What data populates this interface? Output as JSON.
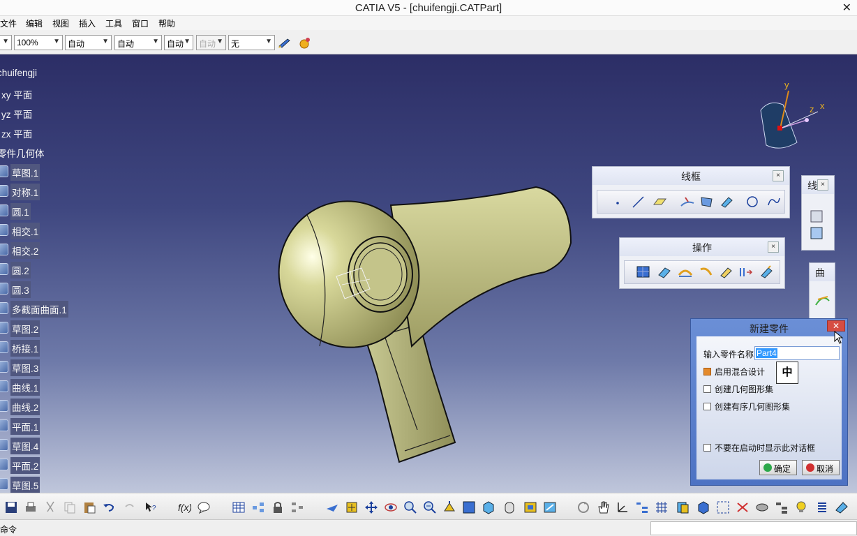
{
  "window": {
    "title": "CATIA V5 - [chuifengji.CATPart]",
    "close_glyph": "✕"
  },
  "menu": [
    "文件",
    "编辑",
    "视图",
    "插入",
    "工具",
    "窗口",
    "帮助"
  ],
  "toolbar": {
    "zoom": "100%",
    "sel_auto1": "自动",
    "sel_auto2": "自动",
    "sel_auto3": "自动",
    "sel_auto4": "自动",
    "sel_none": "无"
  },
  "tree": {
    "root": "chuifengji",
    "items": [
      "xy 平面",
      "yz 平面",
      "zx 平面",
      "零件几何体",
      "草图.1",
      "对称.1",
      "圆.1",
      "相交.1",
      "相交.2",
      "圆.2",
      "圆.3",
      "多截面曲面.1",
      "草图.2",
      "桥接.1",
      "草图.3",
      "曲线.1",
      "曲线.2",
      "平面.1",
      "草图.4",
      "平面.2",
      "草图.5"
    ]
  },
  "compass": {
    "y": "y",
    "z": "z",
    "x": "x"
  },
  "toolbars": {
    "wireframe_title": "线框",
    "operations_title": "操作",
    "partial_title_1": "线",
    "partial_title_2": "曲",
    "close": "×"
  },
  "dialog": {
    "title": "新建零件",
    "close": "✕",
    "name_label": "输入零件名称",
    "name_value": "Part4",
    "ime": "中",
    "opt_hybrid": "启用混合设计",
    "opt_geoset": "创建几何图形集",
    "opt_ordered": "创建有序几何图形集",
    "opt_noshow": "不要在启动时显示此对话框",
    "ok": "确定",
    "cancel": "取消"
  },
  "status": {
    "text": "命令"
  }
}
